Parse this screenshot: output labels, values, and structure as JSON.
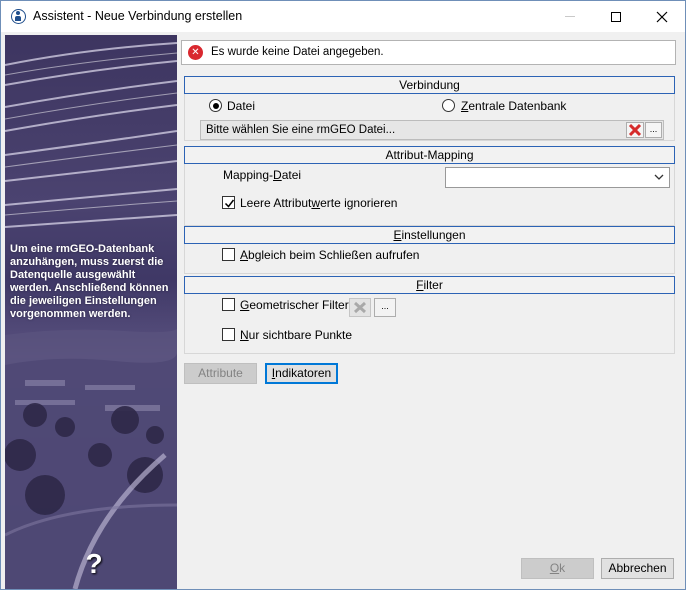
{
  "window": {
    "title": "Assistent - Neue Verbindung erstellen",
    "app_icon": "assistant-icon",
    "controls": [
      "minimize",
      "maximize",
      "close"
    ]
  },
  "side_panel": {
    "text": "Um eine rmGEO-Datenbank anzuhängen, muss zuerst die Datenquelle ausgewählt werden. Anschließend können die jeweiligen Einstellungen vorgenommen werden.",
    "help_glyph": "?"
  },
  "error": {
    "icon": "error-icon",
    "message": "Es wurde keine Datei angegeben."
  },
  "verbindung": {
    "header": "Verbindung",
    "radio_datei": "Datei",
    "radio_zentrale": "Zentrale Datenbank",
    "selected": "Datei",
    "file_placeholder": "Bitte wählen Sie eine rmGEO Datei...",
    "browse_label": "..."
  },
  "mapping": {
    "header": "Attribut-Mapping",
    "mapping_label": "Mapping-Datei",
    "mapping_value": "",
    "ignore_empty_label": "Leere Attributwerte ignorieren",
    "ignore_empty_checked": true
  },
  "einstellungen": {
    "header": "Einstellungen",
    "sync_label": "Abgleich beim Schließen aufrufen",
    "sync_checked": false
  },
  "filter": {
    "header": "Filter",
    "geo_filter_label": "Geometrischer Filter",
    "geo_filter_checked": false,
    "visible_points_label": "Nur sichtbare Punkte",
    "visible_points_checked": false,
    "browse_label": "..."
  },
  "buttons": {
    "attribute": "Attribute",
    "indikatoren": "Indikatoren",
    "ok": "Ok",
    "abbrechen": "Abbrechen"
  },
  "colors": {
    "group_header_border": "#2c63b5",
    "error_red": "#d9282f",
    "focus_blue": "#0078d7",
    "side_panel": "#4b4370"
  }
}
